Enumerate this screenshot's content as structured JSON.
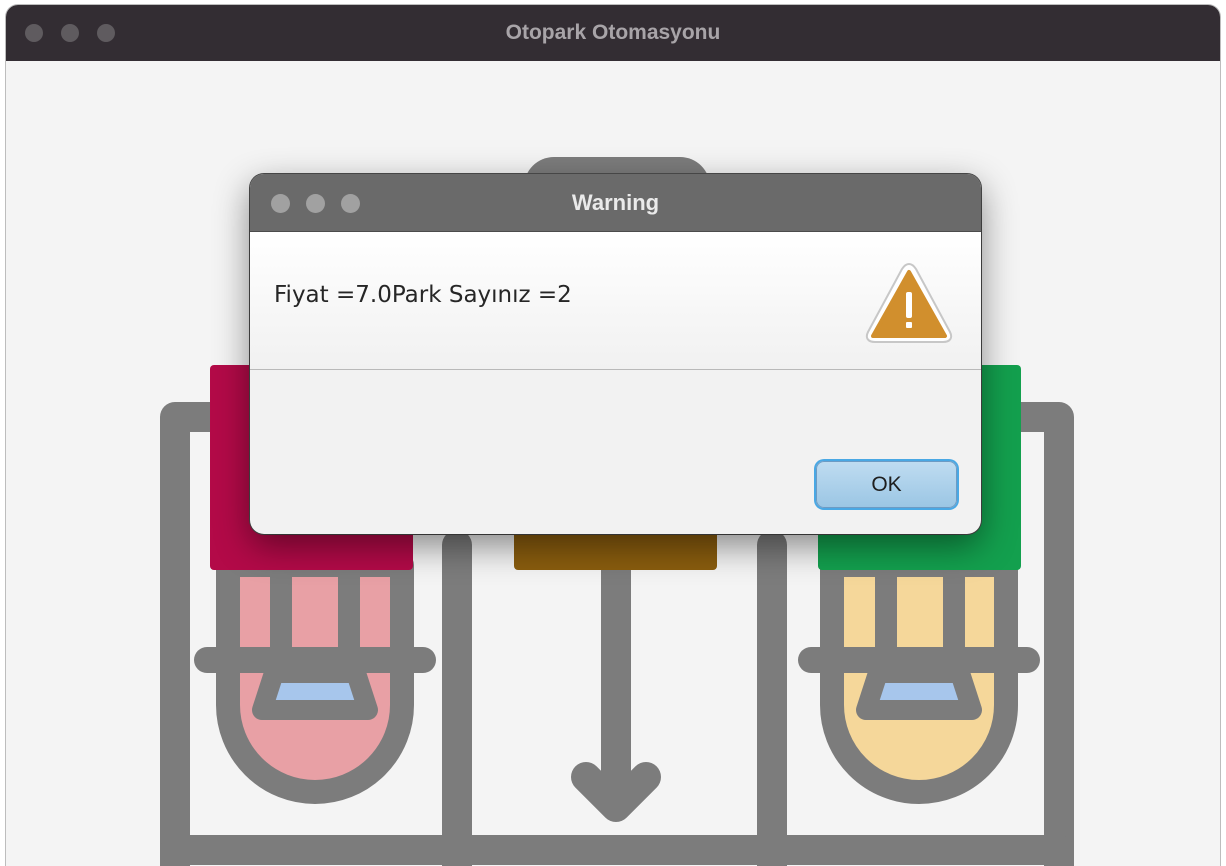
{
  "window": {
    "title": "Otopark Otomasyonu"
  },
  "dialog": {
    "title": "Warning",
    "message": "Fiyat =7.0Park Sayınız =2",
    "ok_label": "OK",
    "icon": "warning-triangle-icon"
  },
  "colors": {
    "spot_left": "#b30a48",
    "spot_middle": "#8a5d0e",
    "spot_right": "#13a04e",
    "car_left": "#e8a0a5",
    "car_right": "#f5d79a",
    "warning_icon": "#d18f2d"
  }
}
